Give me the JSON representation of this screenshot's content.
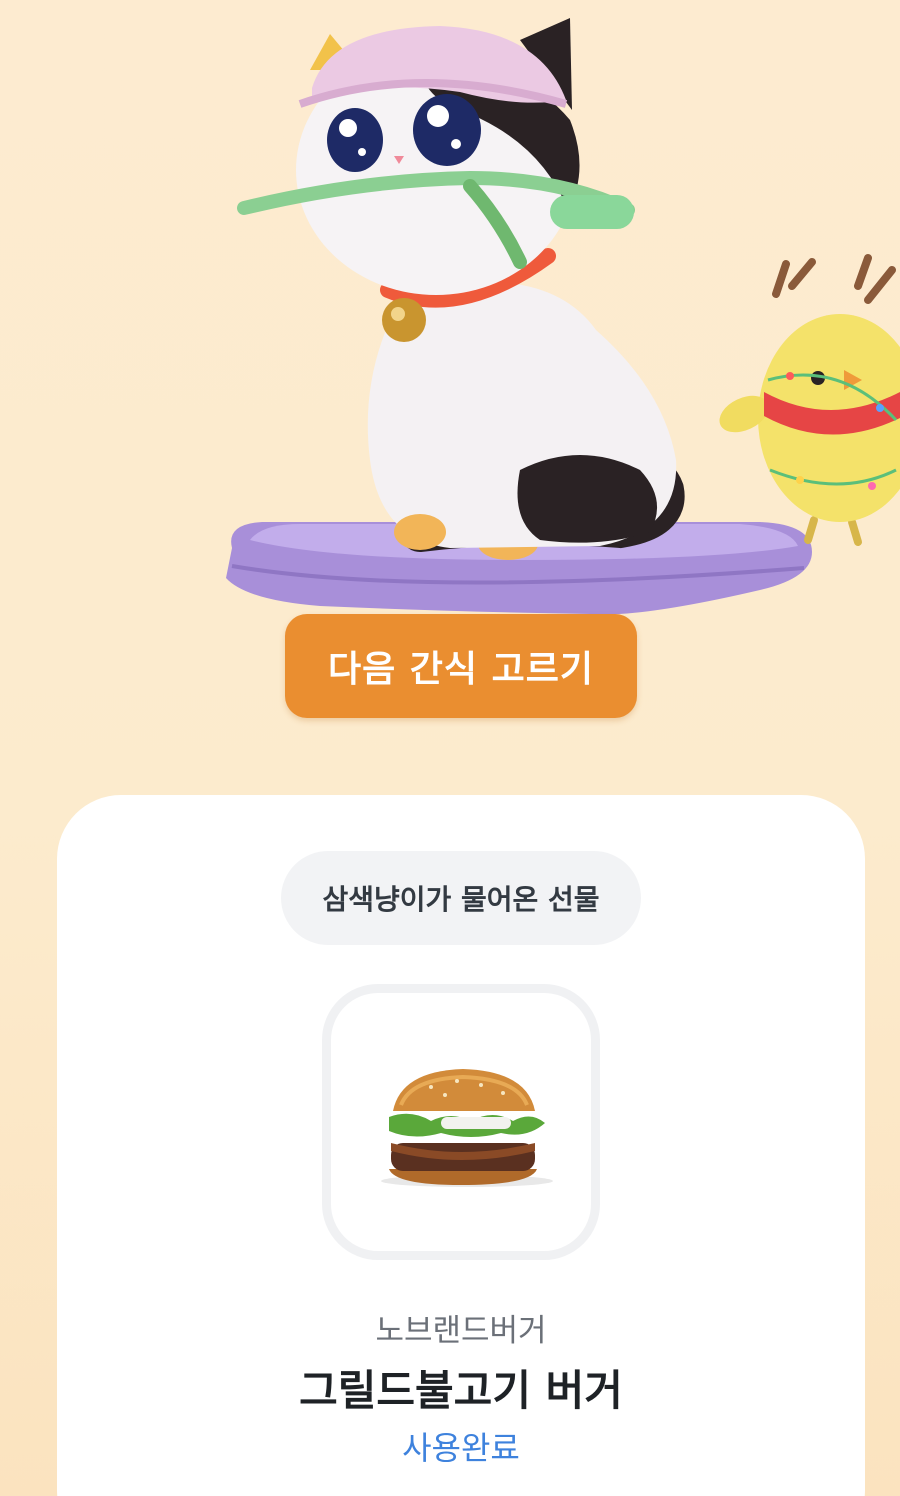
{
  "actions": {
    "next_snack_label": "다음 간식 고르기"
  },
  "gift_card": {
    "header": "삼색냥이가 물어온 선물",
    "brand": "노브랜드버거",
    "product_name": "그릴드불고기 버거",
    "status": "사용완료"
  },
  "colors": {
    "accent": "#ea8e30",
    "status_blue": "#3e82dd",
    "background": "#fdebd0"
  },
  "icons": [
    "calico-cat-character",
    "chick-reindeer-character",
    "cushion",
    "burger-image"
  ]
}
